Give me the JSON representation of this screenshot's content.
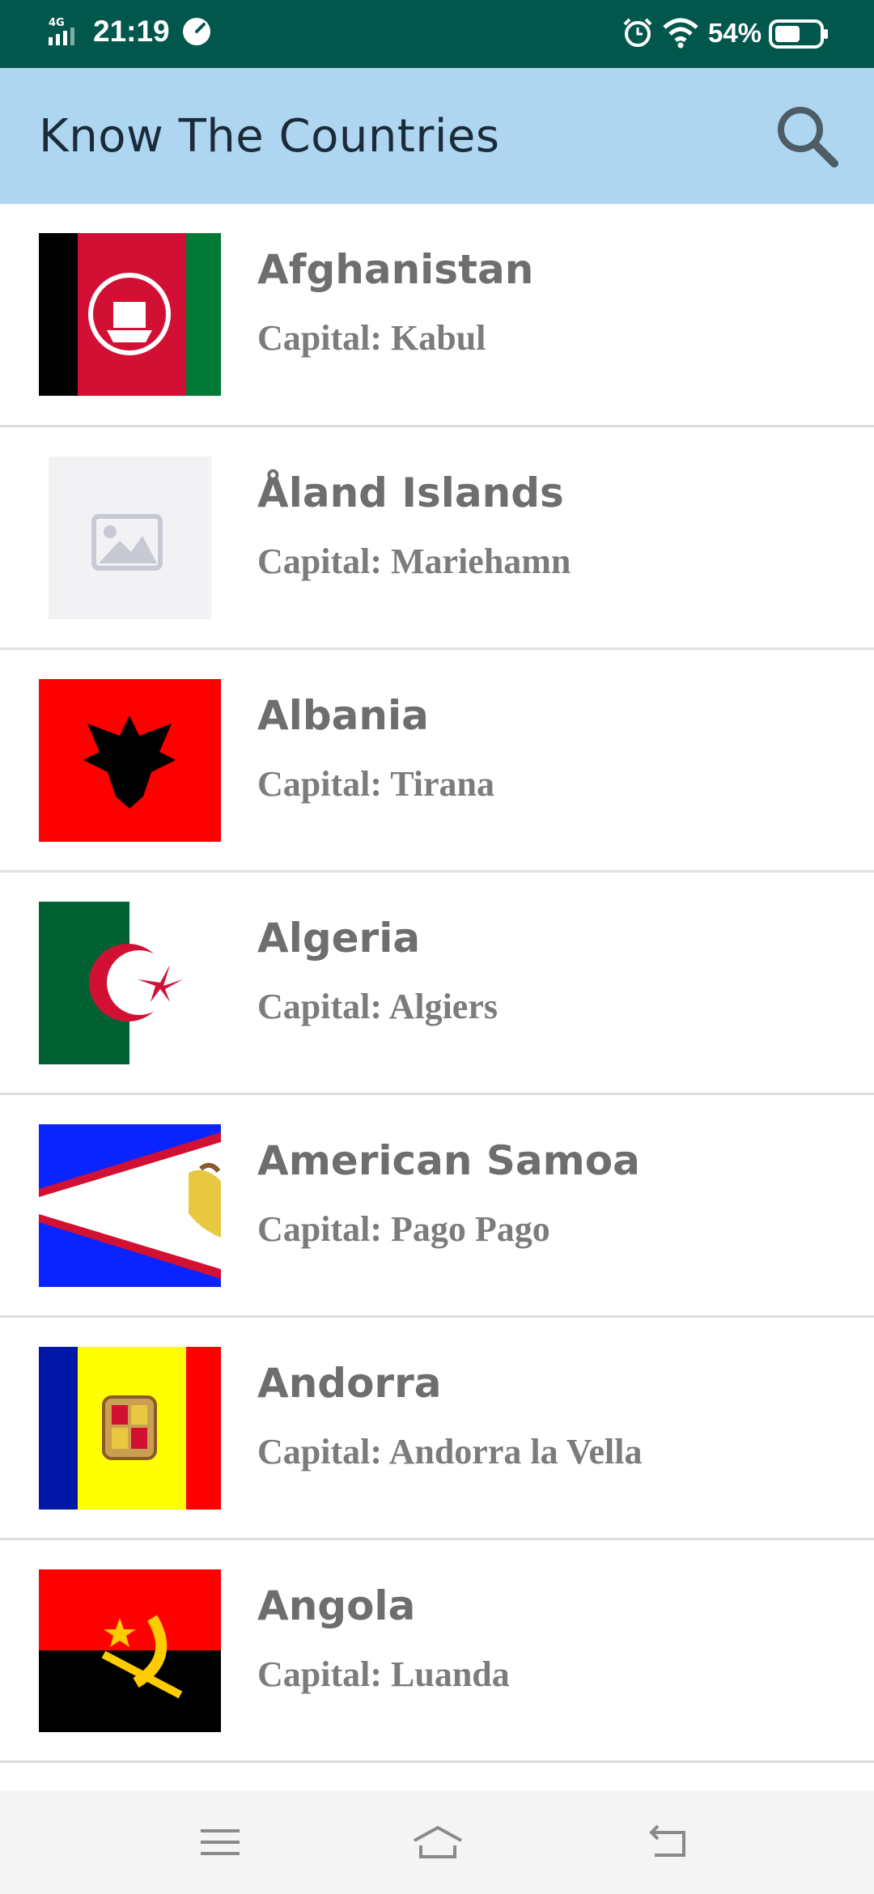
{
  "status_bar": {
    "network": "4G",
    "time": "21:19",
    "battery_percent": "54%",
    "icons": [
      "signal-icon",
      "speed-icon",
      "alarm-icon",
      "wifi-icon",
      "battery-icon"
    ]
  },
  "app_bar": {
    "title": "Know The Countries",
    "search_icon": "search-icon"
  },
  "countries": [
    {
      "name": "Afghanistan",
      "capital": "Capital: Kabul",
      "flag": "afghanistan"
    },
    {
      "name": "Åland Islands",
      "capital": "Capital: Mariehamn",
      "flag": "placeholder-image"
    },
    {
      "name": "Albania",
      "capital": "Capital: Tirana",
      "flag": "albania"
    },
    {
      "name": "Algeria",
      "capital": "Capital: Algiers",
      "flag": "algeria"
    },
    {
      "name": "American Samoa",
      "capital": "Capital: Pago Pago",
      "flag": "american-samoa"
    },
    {
      "name": "Andorra",
      "capital": "Capital: Andorra la Vella",
      "flag": "andorra"
    },
    {
      "name": "Angola",
      "capital": "Capital: Luanda",
      "flag": "angola"
    }
  ],
  "nav_bar": {
    "icons": [
      "menu-icon",
      "home-icon",
      "back-icon"
    ]
  },
  "colors": {
    "status_bar": "#02574c",
    "app_bar": "#aed6f1",
    "title_text": "#1c2b3a",
    "row_text": "#6e6e6e",
    "divider": "#dedede"
  }
}
